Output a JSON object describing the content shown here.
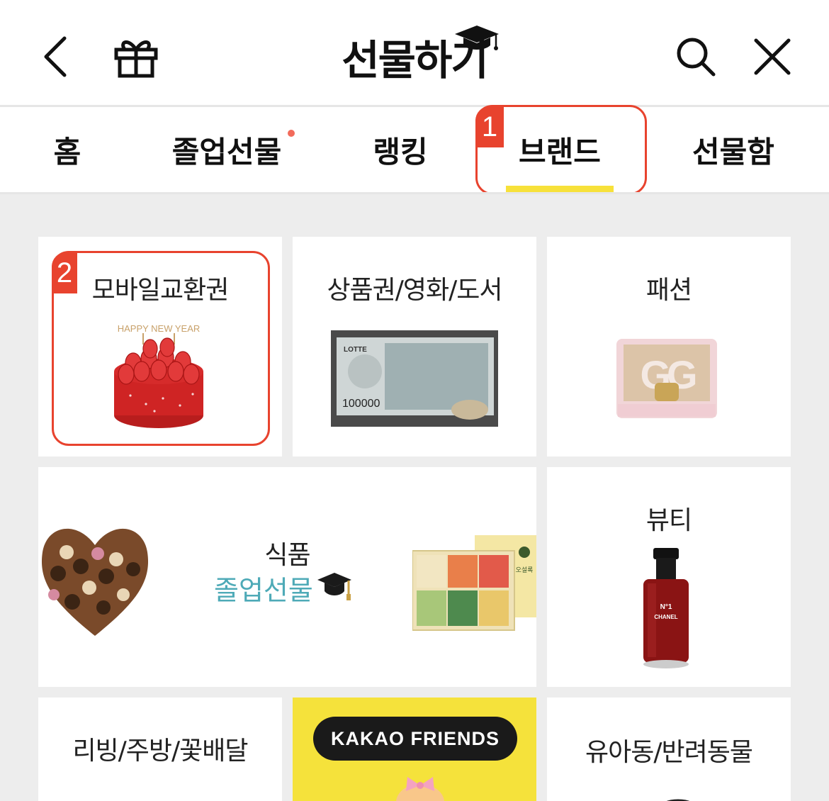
{
  "header": {
    "title": "선물하기",
    "icons": {
      "back": "chevron-left-icon",
      "gift": "gift-icon",
      "cap": "graduation-cap-icon",
      "search": "search-icon",
      "close": "close-icon"
    }
  },
  "tabs": [
    {
      "label": "홈"
    },
    {
      "label": "졸업선물",
      "has_dot": true
    },
    {
      "label": "랭킹"
    },
    {
      "label": "브랜드",
      "active": true
    },
    {
      "label": "선물함"
    }
  ],
  "annotations": {
    "tab_marker": "1",
    "card_marker": "2"
  },
  "categories": {
    "mobile_voucher": "모바일교환권",
    "gift_card": "상품권/영화/도서",
    "fashion": "패션",
    "food": "식품",
    "food_sub": "졸업선물",
    "beauty": "뷰티",
    "living": "리빙/주방/꽃배달",
    "kakao": "KAKAO FRIENDS",
    "kids_pets": "유아동/반려동물"
  },
  "image_text": {
    "cake_topper": "HAPPY NEW YEAR",
    "voucher_brand": "LOTTE",
    "voucher_amount": "100000",
    "tea_brand": "오설록",
    "perfume_name": "N°1",
    "perfume_brand": "CHANEL"
  },
  "colors": {
    "accent_red": "#e8432e",
    "tab_underline": "#f7e13a",
    "food_sub": "#4eaab7",
    "kakao_yellow": "#f5e23b"
  }
}
